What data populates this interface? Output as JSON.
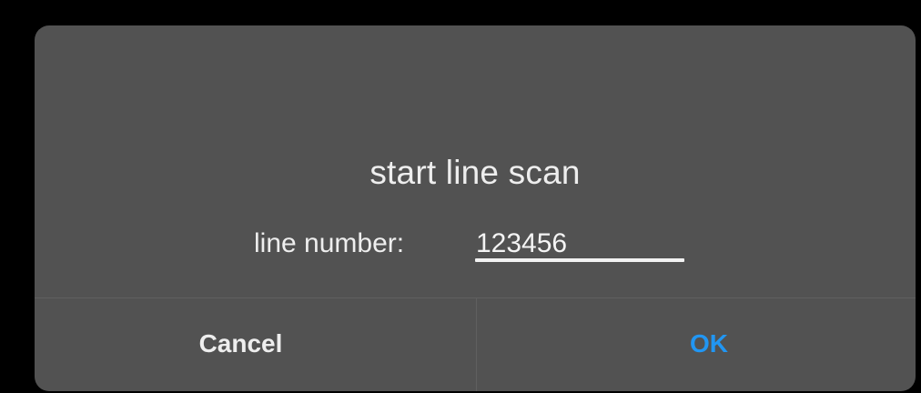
{
  "dialog": {
    "title": "start line scan",
    "field": {
      "label": "line number:",
      "value": "123456"
    },
    "buttons": {
      "cancel_label": "Cancel",
      "ok_label": "OK"
    },
    "colors": {
      "background": "#000000",
      "dialog_background": "#525252",
      "text": "#eeeeee",
      "accent": "#2196f3",
      "divider": "#5f5f5f"
    }
  }
}
